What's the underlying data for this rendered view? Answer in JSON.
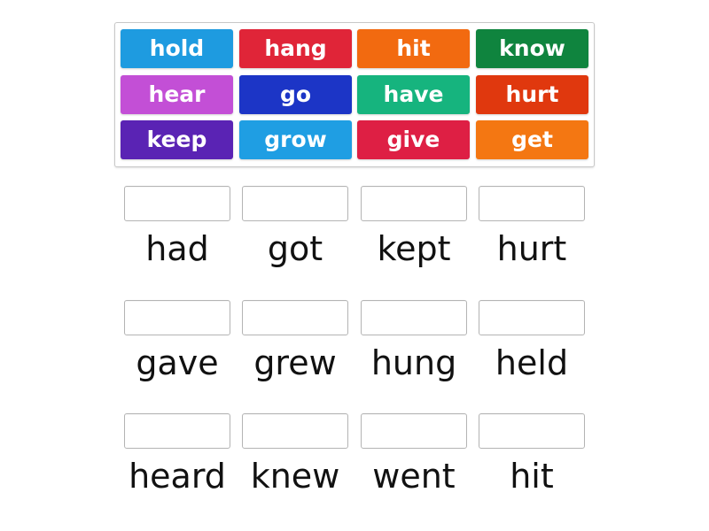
{
  "tiles": [
    {
      "label": "hold",
      "color": "#1e9be0"
    },
    {
      "label": "hang",
      "color": "#e02538"
    },
    {
      "label": "hit",
      "color": "#f26a10"
    },
    {
      "label": "know",
      "color": "#0f843e"
    },
    {
      "label": "hear",
      "color": "#c34fd6"
    },
    {
      "label": "go",
      "color": "#1c35c6"
    },
    {
      "label": "have",
      "color": "#16b47e"
    },
    {
      "label": "hurt",
      "color": "#e0380e"
    },
    {
      "label": "keep",
      "color": "#5a23b4"
    },
    {
      "label": "grow",
      "color": "#1f9ee3"
    },
    {
      "label": "give",
      "color": "#de1f44"
    },
    {
      "label": "get",
      "color": "#f47712"
    }
  ],
  "answers": [
    {
      "label": "had"
    },
    {
      "label": "got"
    },
    {
      "label": "kept"
    },
    {
      "label": "hurt"
    },
    {
      "label": "gave"
    },
    {
      "label": "grew"
    },
    {
      "label": "hung"
    },
    {
      "label": "held"
    },
    {
      "label": "heard"
    },
    {
      "label": "knew"
    },
    {
      "label": "went"
    },
    {
      "label": "hit"
    }
  ]
}
